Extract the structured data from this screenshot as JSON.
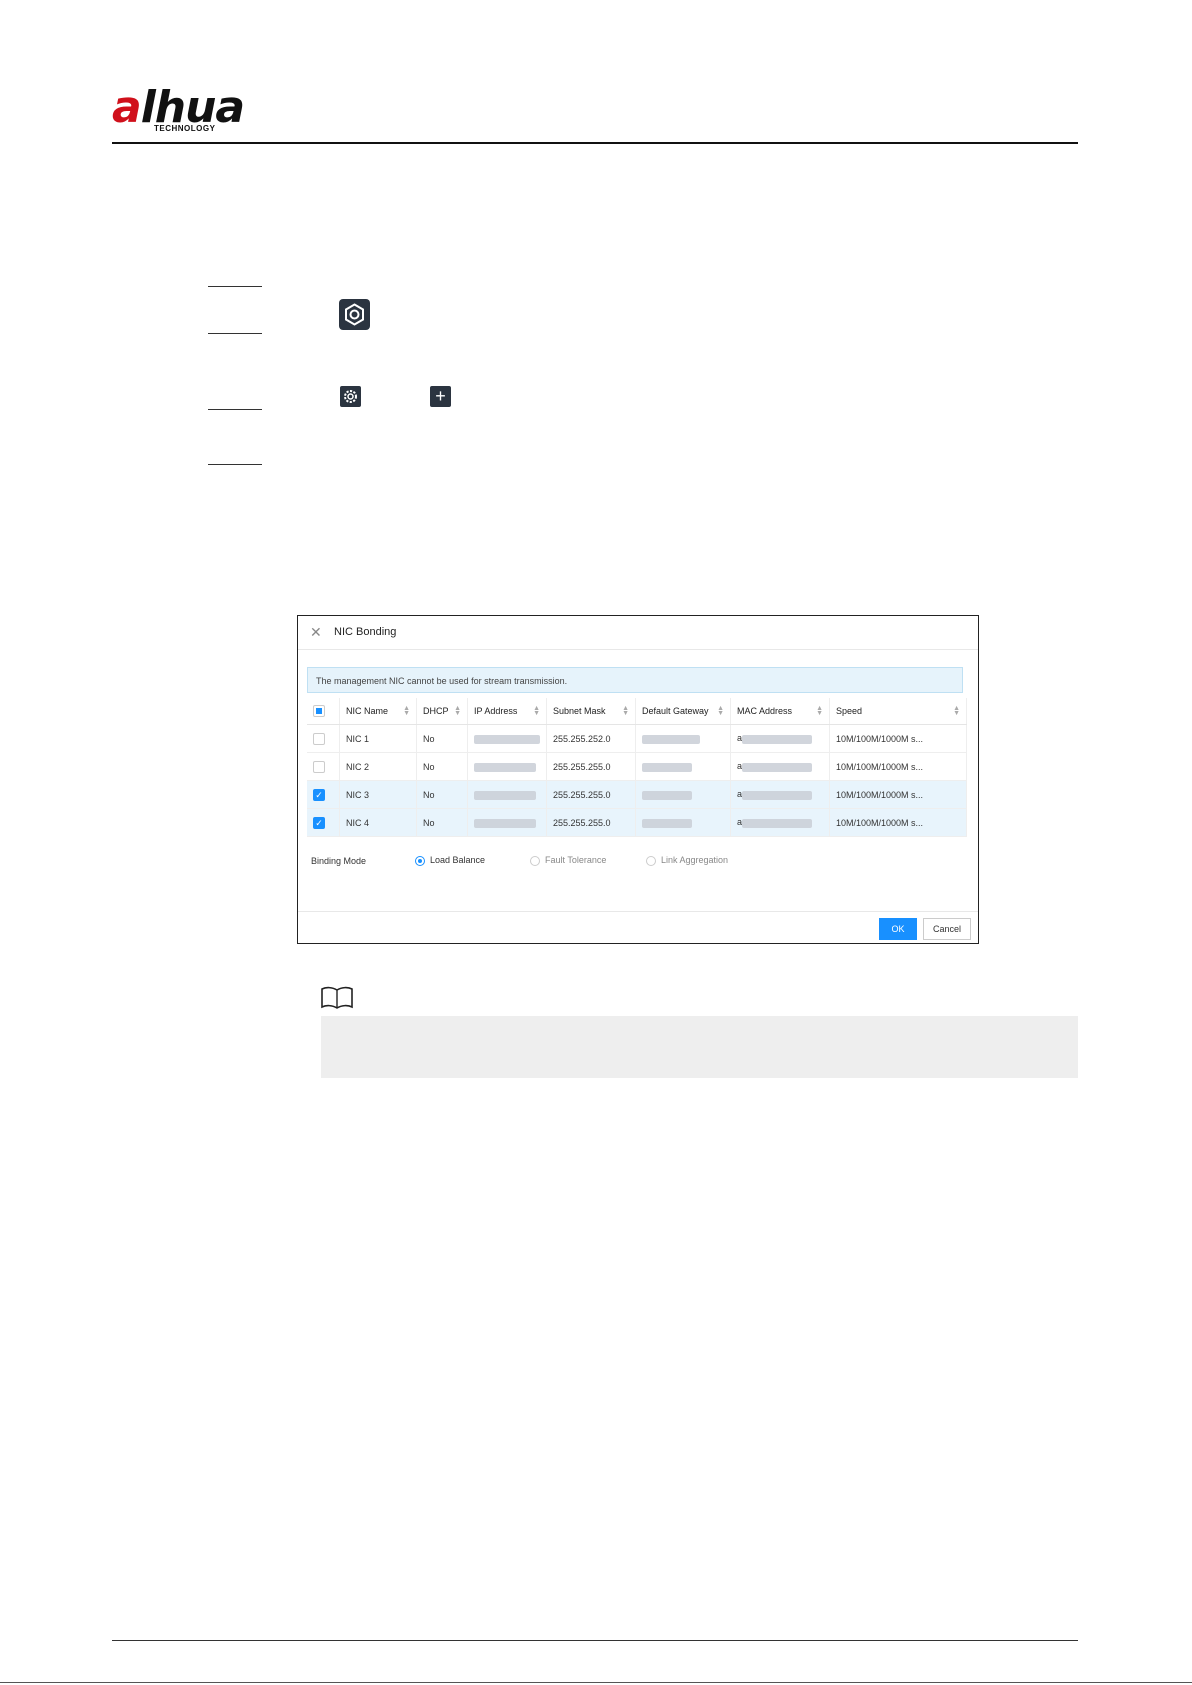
{
  "header": {
    "logo_text": "alhua",
    "logo_sub": "TECHNOLOGY"
  },
  "dialog": {
    "title": "NIC Bonding",
    "notice": "The management NIC cannot be used for stream transmission.",
    "columns": [
      "NIC Name",
      "DHCP",
      "IP Address",
      "Subnet Mask",
      "Default Gateway",
      "MAC Address",
      "Speed"
    ],
    "rows": [
      {
        "name": "NIC 1",
        "dhcp": "No",
        "subnet": "255.255.252.0",
        "mac_prefix": "a",
        "speed": "10M/100M/1000M s...",
        "checked": false
      },
      {
        "name": "NIC 2",
        "dhcp": "No",
        "subnet": "255.255.255.0",
        "mac_prefix": "a",
        "speed": "10M/100M/1000M s...",
        "checked": false
      },
      {
        "name": "NIC 3",
        "dhcp": "No",
        "subnet": "255.255.255.0",
        "mac_prefix": "a",
        "speed": "10M/100M/1000M s...",
        "checked": true
      },
      {
        "name": "NIC 4",
        "dhcp": "No",
        "subnet": "255.255.255.0",
        "mac_prefix": "a",
        "speed": "10M/100M/1000M s...",
        "checked": true
      }
    ],
    "binding_mode_label": "Binding Mode",
    "binding_modes": [
      "Load Balance",
      "Fault Tolerance",
      "Link Aggregation"
    ],
    "selected_mode": "Load Balance",
    "ok_label": "OK",
    "cancel_label": "Cancel"
  },
  "colors": {
    "accent": "#1890ff",
    "brand_red": "#d0101b",
    "icon_bg": "#2b3440"
  },
  "icons": [
    "hexagon-settings-icon",
    "gear-icon",
    "plus-icon",
    "book-note-icon",
    "close-icon"
  ]
}
